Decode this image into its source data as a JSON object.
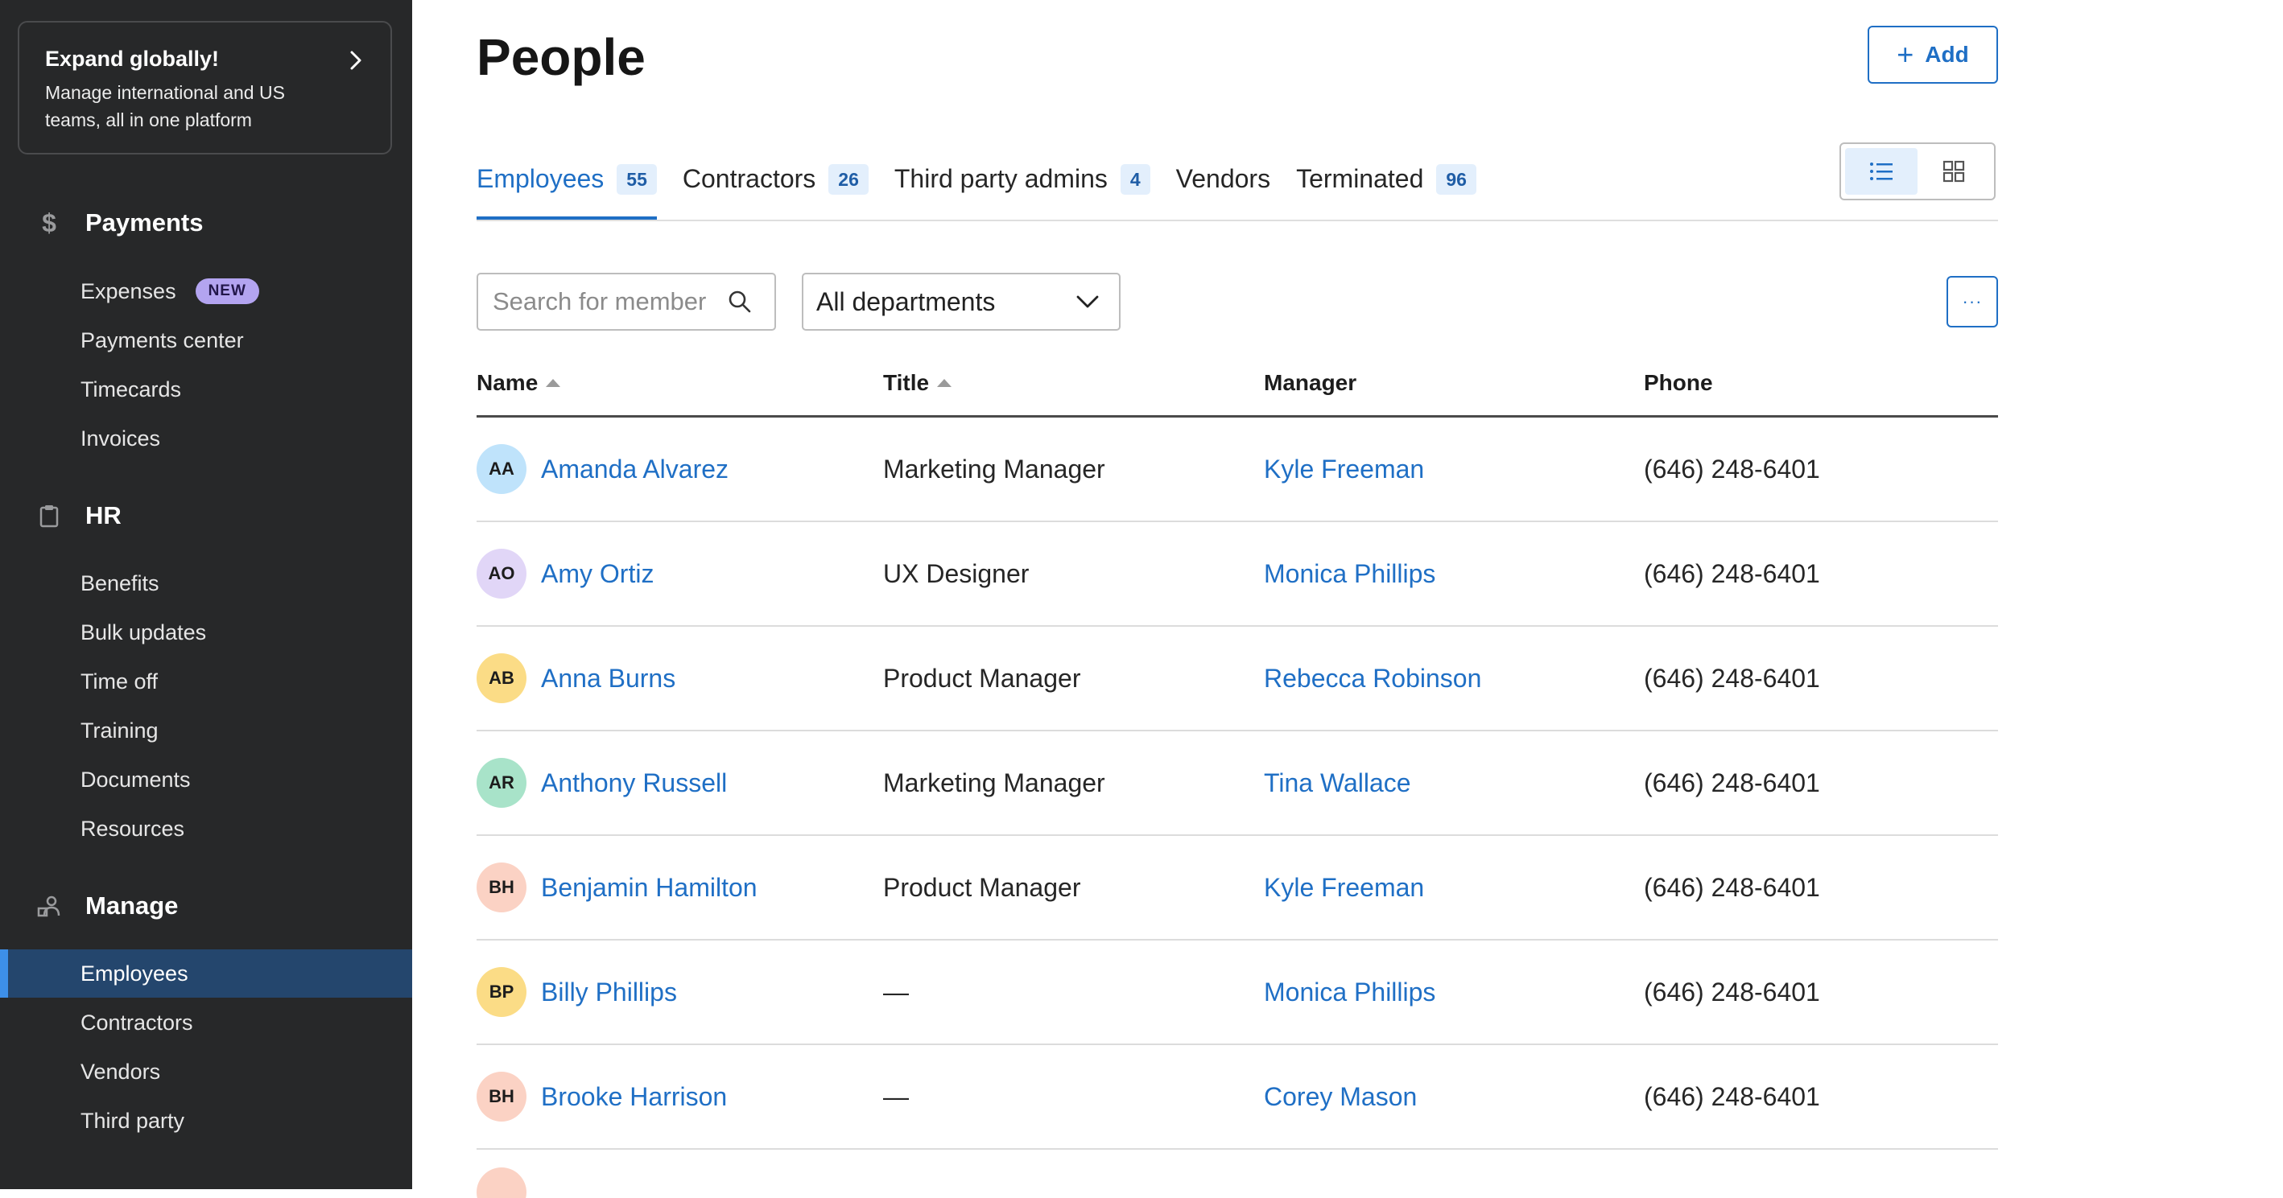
{
  "promo": {
    "title": "Expand globally!",
    "description": "Manage international and US teams, all in one platform",
    "arrow_icon": "chevron-right-icon"
  },
  "sidebar": {
    "sections": [
      {
        "label": "Payments",
        "icon": "dollar-icon"
      },
      {
        "label": "HR",
        "icon": "clipboard-icon"
      },
      {
        "label": "Manage",
        "icon": "people-icon"
      }
    ],
    "payments_items": [
      {
        "label": "Expenses",
        "badge": "NEW"
      },
      {
        "label": "Payments center"
      },
      {
        "label": "Timecards"
      },
      {
        "label": "Invoices"
      }
    ],
    "hr_items": [
      {
        "label": "Benefits"
      },
      {
        "label": "Bulk updates"
      },
      {
        "label": "Time off"
      },
      {
        "label": "Training"
      },
      {
        "label": "Documents"
      },
      {
        "label": "Resources"
      }
    ],
    "manage_items": [
      {
        "label": "Employees",
        "active": true
      },
      {
        "label": "Contractors"
      },
      {
        "label": "Vendors"
      },
      {
        "label": "Third party"
      }
    ]
  },
  "header": {
    "title": "People",
    "add_label": "Add"
  },
  "tabs": [
    {
      "label": "Employees",
      "count": "55",
      "active": true
    },
    {
      "label": "Contractors",
      "count": "26"
    },
    {
      "label": "Third party admins",
      "count": "4"
    },
    {
      "label": "Vendors",
      "count": ""
    },
    {
      "label": "Terminated",
      "count": "96"
    }
  ],
  "view_toggle": {
    "list_icon": "list-view-icon",
    "grid_icon": "grid-view-icon",
    "selected": "list"
  },
  "filters": {
    "search_placeholder": "Search for member",
    "department_value": "All departments",
    "more_label": "···"
  },
  "table": {
    "columns": [
      "Name",
      "Title",
      "Manager",
      "Phone"
    ],
    "rows": [
      {
        "initials": "AA",
        "name": "Amanda Alvarez",
        "title": "Marketing Manager",
        "manager": "Kyle Freeman",
        "phone": "(646) 248-6401"
      },
      {
        "initials": "AO",
        "name": "Amy Ortiz",
        "title": "UX Designer",
        "manager": "Monica Phillips",
        "phone": "(646) 248-6401"
      },
      {
        "initials": "AB",
        "name": "Anna Burns",
        "title": "Product Manager",
        "manager": "Rebecca Robinson",
        "phone": "(646) 248-6401"
      },
      {
        "initials": "AR",
        "name": "Anthony Russell",
        "title": "Marketing Manager",
        "manager": "Tina Wallace",
        "phone": "(646) 248-6401"
      },
      {
        "initials": "BH",
        "name": "Benjamin Hamilton",
        "title": "Product Manager",
        "manager": "Kyle Freeman",
        "phone": "(646) 248-6401"
      },
      {
        "initials": "BP",
        "name": "Billy Phillips",
        "title": "—",
        "manager": "Monica Phillips",
        "phone": "(646) 248-6401"
      },
      {
        "initials": "BH",
        "name": "Brooke Harrison",
        "title": "—",
        "manager": "Corey Mason",
        "phone": "(646) 248-6401"
      }
    ],
    "avatar_colors": [
      "#bfe3fb",
      "#e1d6f7",
      "#fbdc86",
      "#a8e3c9",
      "#fbd2c4",
      "#fbdc86",
      "#fbd2c4",
      "#fbd2c4"
    ]
  },
  "colors": {
    "accent": "#1f6fc5",
    "sidebar_bg": "#272829",
    "sidebar_active": "#24466d"
  }
}
